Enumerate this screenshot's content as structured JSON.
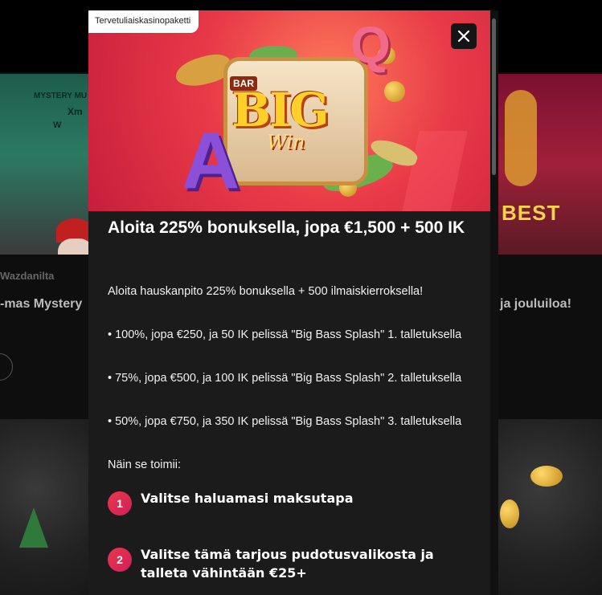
{
  "background": {
    "left_card": {
      "brand_line1": "MYSTERY MU",
      "brand_line2": "Xm",
      "brand_line3": "W",
      "caption": "Wazdanilta",
      "title": "-mas Mystery"
    },
    "right_card": {
      "brand": "BEST",
      "title": "ja jouluiloa!"
    }
  },
  "modal": {
    "badge": "Tervetuliaiskasinopaketti",
    "hero_words": {
      "big": "BIG",
      "win": "Win",
      "bar": "BAR"
    },
    "headline": "Aloita 225% bonuksella, jopa €1,500 + 500 IK",
    "intro": "Aloita hauskanpito 225% bonuksella + 500 ilmaiskierroksella!",
    "bullets": [
      "• 100%, jopa €250, ja 50 IK pelissä \"Big Bass Splash\" 1. talletuksella",
      "• 75%, jopa €500, ja 100 IK pelissä \"Big Bass Splash\" 2. talletuksella",
      "• 50%, jopa €750, ja 350 IK pelissä \"Big Bass Splash\" 3. talletuksella"
    ],
    "how_it_works": "Näin se toimii:",
    "steps": [
      {
        "number": "1",
        "text": "Valitse haluamasi maksutapa"
      },
      {
        "number": "2",
        "text": "Valitse tämä tarjous pudotusvalikosta ja talleta vähintään €25+"
      }
    ]
  },
  "colors": {
    "modal_bg": "#1b1b1b",
    "page_bg": "#0e0e0e",
    "step_badge": "#e8394a",
    "close_button_bg": "#151515"
  },
  "icons": {
    "close": "close-icon"
  }
}
